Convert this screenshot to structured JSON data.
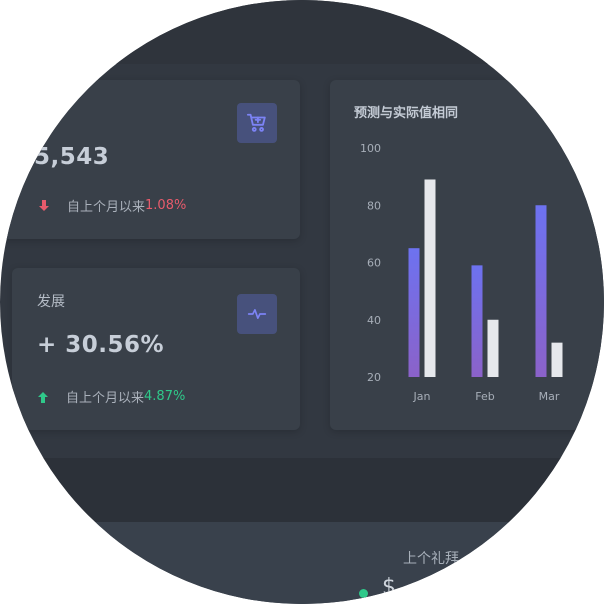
{
  "colors": {
    "background": "#323841",
    "card": "#394049",
    "accent": "#6d72f0",
    "accent_dark": "#8b62c9",
    "bar_light": "#e6e8ec",
    "down": "#e85b6c",
    "up": "#2fc98a"
  },
  "sales_card": {
    "value": "5,543",
    "trend_text": "自上个月以来",
    "trend_value": "1.08%",
    "trend_direction": "down",
    "icon": "cart-icon"
  },
  "growth_card": {
    "title": "发展",
    "value": "+ 30.56%",
    "trend_text": "自上个月以来",
    "trend_value": "4.87%",
    "trend_direction": "up",
    "icon": "pulse-icon"
  },
  "chart_card": {
    "title": "预测与实际值相同"
  },
  "chart_data": {
    "type": "bar",
    "title": "预测与实际值相同",
    "categories": [
      "Jan",
      "Feb",
      "Mar"
    ],
    "series": [
      {
        "values": [
          65,
          59,
          80
        ],
        "color": "#6d72f0"
      },
      {
        "values": [
          89,
          40,
          32
        ],
        "color": "#e6e8ec"
      }
    ],
    "yticks": [
      "100",
      "80",
      "60",
      "40",
      "20"
    ],
    "ylim": [
      20,
      100
    ],
    "grid": false,
    "legend": "none"
  },
  "bottom_panel": {
    "label": "上个礼拜",
    "glyph": "$"
  }
}
